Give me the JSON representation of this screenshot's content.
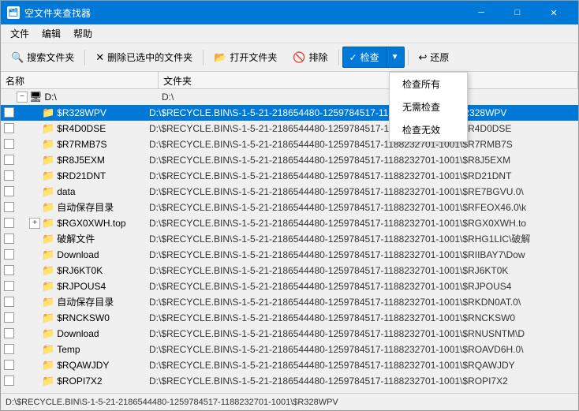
{
  "window": {
    "title": "空文件夹查找器",
    "titlebar_icon": "🗂"
  },
  "titlebar_controls": {
    "minimize": "─",
    "maximize": "□",
    "close": "✕"
  },
  "menubar": {
    "items": [
      "文件",
      "编辑",
      "帮助"
    ]
  },
  "toolbar": {
    "search_folder": "搜索文件夹",
    "delete_selected": "删除已选中的文件夹",
    "open_folder": "打开文件夹",
    "exclude": "排除",
    "check": "检查",
    "restore": "还原",
    "check_all": "检查所有",
    "no_check": "无需检查",
    "check_invalid": "检查无效"
  },
  "list_headers": {
    "name": "名称",
    "folder": "文件夹"
  },
  "rows": [
    {
      "indent": 0,
      "expand": "−",
      "icon": "🖥",
      "name": "D:\\",
      "path": "D:\\",
      "selected": false,
      "is_drive": true
    },
    {
      "indent": 1,
      "expand": null,
      "icon": "📁",
      "name": "$R328WPV",
      "path": "D:\\$RECYCLE.BIN\\S-1-5-21-218654480-1259784517-1188232701-1001\\$R328WPV",
      "selected": true
    },
    {
      "indent": 1,
      "expand": null,
      "icon": "📁",
      "name": "$R4D0DSE",
      "path": "D:\\$RECYCLE.BIN\\S-1-5-21-2186544480-1259784517-1188232701-1001\\$R4D0DSE",
      "selected": false
    },
    {
      "indent": 1,
      "expand": null,
      "icon": "📁",
      "name": "$R7RMB7S",
      "path": "D:\\$RECYCLE.BIN\\S-1-5-21-2186544480-1259784517-1188232701-1001\\$R7RMB7S",
      "selected": false
    },
    {
      "indent": 1,
      "expand": null,
      "icon": "📁",
      "name": "$R8J5EXM",
      "path": "D:\\$RECYCLE.BIN\\S-1-5-21-2186544480-1259784517-1188232701-1001\\$R8J5EXM",
      "selected": false
    },
    {
      "indent": 1,
      "expand": null,
      "icon": "📁",
      "name": "$RD21DNT",
      "path": "D:\\$RECYCLE.BIN\\S-1-5-21-2186544480-1259784517-1188232701-1001\\$RD21DNT",
      "selected": false
    },
    {
      "indent": 1,
      "expand": null,
      "icon": "📁",
      "name": "data",
      "path": "D:\\$RECYCLE.BIN\\S-1-5-21-2186544480-1259784517-1188232701-1001\\$RE7BGVU.0\\",
      "selected": false
    },
    {
      "indent": 1,
      "expand": null,
      "icon": "📁",
      "name": "自动保存目录",
      "path": "D:\\$RECYCLE.BIN\\S-1-5-21-2186544480-1259784517-1188232701-1001\\$RFEOX46.0\\k",
      "selected": false
    },
    {
      "indent": 1,
      "expand": "+",
      "icon": "📁",
      "name": "$RGX0XWH.top",
      "path": "D:\\$RECYCLE.BIN\\S-1-5-21-2186544480-1259784517-1188232701-1001\\$RGX0XWH.to",
      "selected": false
    },
    {
      "indent": 1,
      "expand": null,
      "icon": "📁",
      "name": "破解文件",
      "path": "D:\\$RECYCLE.BIN\\S-1-5-21-2186544480-1259784517-1188232701-1001\\$RHG1LIC\\破解",
      "selected": false
    },
    {
      "indent": 1,
      "expand": null,
      "icon": "📁",
      "name": "Download",
      "path": "D:\\$RECYCLE.BIN\\S-1-5-21-2186544480-1259784517-1188232701-1001\\$RIIBAY7\\Dow",
      "selected": false
    },
    {
      "indent": 1,
      "expand": null,
      "icon": "📁",
      "name": "$RJ6KT0K",
      "path": "D:\\$RECYCLE.BIN\\S-1-5-21-2186544480-1259784517-1188232701-1001\\$RJ6KT0K",
      "selected": false
    },
    {
      "indent": 1,
      "expand": null,
      "icon": "📁",
      "name": "$RJPOUS4",
      "path": "D:\\$RECYCLE.BIN\\S-1-5-21-2186544480-1259784517-1188232701-1001\\$RJPOUS4",
      "selected": false
    },
    {
      "indent": 1,
      "expand": null,
      "icon": "📁",
      "name": "自动保存目录",
      "path": "D:\\$RECYCLE.BIN\\S-1-5-21-2186544480-1259784517-1188232701-1001\\$RKDN0AT.0\\",
      "selected": false
    },
    {
      "indent": 1,
      "expand": null,
      "icon": "📁",
      "name": "$RNCKSW0",
      "path": "D:\\$RECYCLE.BIN\\S-1-5-21-2186544480-1259784517-1188232701-1001\\$RNCKSW0",
      "selected": false
    },
    {
      "indent": 1,
      "expand": null,
      "icon": "📁",
      "name": "Download",
      "path": "D:\\$RECYCLE.BIN\\S-1-5-21-2186544480-1259784517-1188232701-1001\\$RNUSNTM\\D",
      "selected": false
    },
    {
      "indent": 1,
      "expand": null,
      "icon": "📁",
      "name": "Temp",
      "path": "D:\\$RECYCLE.BIN\\S-1-5-21-2186544480-1259784517-1188232701-1001\\$ROAVD6H.0\\",
      "selected": false
    },
    {
      "indent": 1,
      "expand": null,
      "icon": "📁",
      "name": "$RQAWJDY",
      "path": "D:\\$RECYCLE.BIN\\S-1-5-21-2186544480-1259784517-1188232701-1001\\$RQAWJDY",
      "selected": false
    },
    {
      "indent": 1,
      "expand": null,
      "icon": "📁",
      "name": "$ROPI7X2",
      "path": "D:\\$RECYCLE.BIN\\S-1-5-21-2186544480-1259784517-1188232701-1001\\$ROPI7X2",
      "selected": false
    }
  ],
  "statusbar": {
    "text": "D:\\$RECYCLE.BIN\\S-1-5-21-2186544480-1259784517-1188232701-1001\\$R328WPV"
  },
  "dropdown": {
    "visible": true,
    "items": [
      "检查所有",
      "无需检查",
      "检查无效"
    ]
  }
}
